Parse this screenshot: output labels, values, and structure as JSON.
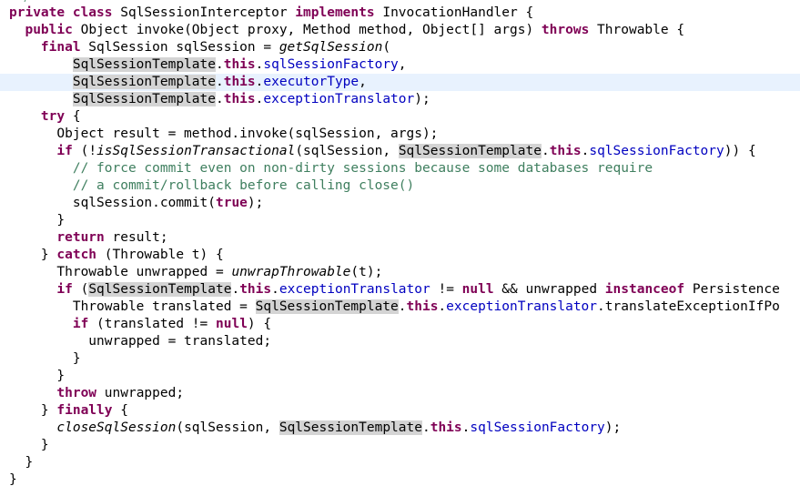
{
  "editor": {
    "lines": [
      [
        {
          "t": "private",
          "c": "kw"
        },
        {
          "t": " "
        },
        {
          "t": "class",
          "c": "kw"
        },
        {
          "t": " SqlSessionInterceptor "
        },
        {
          "t": "implements",
          "c": "kw"
        },
        {
          "t": " InvocationHandler {"
        }
      ],
      [
        {
          "t": "  "
        },
        {
          "t": "public",
          "c": "kw"
        },
        {
          "t": " Object invoke(Object proxy, Method method, Object[] args) "
        },
        {
          "t": "throws",
          "c": "kw"
        },
        {
          "t": " Throwable {"
        }
      ],
      [
        {
          "t": "    "
        },
        {
          "t": "final",
          "c": "kw"
        },
        {
          "t": " SqlSession sqlSession = "
        },
        {
          "t": "getSqlSession",
          "c": "static"
        },
        {
          "t": "("
        }
      ],
      [
        {
          "t": "        "
        },
        {
          "t": "SqlSessionTemplate",
          "c": "hl"
        },
        {
          "t": "."
        },
        {
          "t": "this",
          "c": "kw"
        },
        {
          "t": "."
        },
        {
          "t": "sqlSessionFactory",
          "c": "field"
        },
        {
          "t": ","
        }
      ],
      [
        {
          "t": "        "
        },
        {
          "t": "SqlSessionTemplate",
          "c": "hl"
        },
        {
          "t": "."
        },
        {
          "t": "this",
          "c": "kw"
        },
        {
          "t": "."
        },
        {
          "t": "executorType",
          "c": "field"
        },
        {
          "t": ","
        }
      ],
      [
        {
          "t": "        "
        },
        {
          "t": "SqlSessionTemplate",
          "c": "hl"
        },
        {
          "t": "."
        },
        {
          "t": "this",
          "c": "kw"
        },
        {
          "t": "."
        },
        {
          "t": "exceptionTranslator",
          "c": "field"
        },
        {
          "t": ");"
        }
      ],
      [
        {
          "t": "    "
        },
        {
          "t": "try",
          "c": "kw"
        },
        {
          "t": " {"
        }
      ],
      [
        {
          "t": "      Object result = method.invoke(sqlSession, args);"
        }
      ],
      [
        {
          "t": "      "
        },
        {
          "t": "if",
          "c": "kw"
        },
        {
          "t": " (!"
        },
        {
          "t": "isSqlSessionTransactional",
          "c": "static"
        },
        {
          "t": "(sqlSession, "
        },
        {
          "t": "SqlSessionTemplate",
          "c": "hl"
        },
        {
          "t": "."
        },
        {
          "t": "this",
          "c": "kw"
        },
        {
          "t": "."
        },
        {
          "t": "sqlSessionFactory",
          "c": "field"
        },
        {
          "t": ")) {"
        }
      ],
      [
        {
          "t": "        "
        },
        {
          "t": "// force commit even on non-dirty sessions because some databases require",
          "c": "comment"
        }
      ],
      [
        {
          "t": "        "
        },
        {
          "t": "// a commit/rollback before calling close()",
          "c": "comment"
        }
      ],
      [
        {
          "t": "        sqlSession.commit("
        },
        {
          "t": "true",
          "c": "kw"
        },
        {
          "t": ");"
        }
      ],
      [
        {
          "t": "      }"
        }
      ],
      [
        {
          "t": "      "
        },
        {
          "t": "return",
          "c": "kw"
        },
        {
          "t": " result;"
        }
      ],
      [
        {
          "t": "    } "
        },
        {
          "t": "catch",
          "c": "kw"
        },
        {
          "t": " (Throwable t) {"
        }
      ],
      [
        {
          "t": "      Throwable unwrapped = "
        },
        {
          "t": "unwrapThrowable",
          "c": "static"
        },
        {
          "t": "(t);"
        }
      ],
      [
        {
          "t": "      "
        },
        {
          "t": "if",
          "c": "kw"
        },
        {
          "t": " ("
        },
        {
          "t": "SqlSessionTemplate",
          "c": "hl"
        },
        {
          "t": "."
        },
        {
          "t": "this",
          "c": "kw"
        },
        {
          "t": "."
        },
        {
          "t": "exceptionTranslator",
          "c": "field"
        },
        {
          "t": " != "
        },
        {
          "t": "null",
          "c": "kw"
        },
        {
          "t": " && unwrapped "
        },
        {
          "t": "instanceof",
          "c": "kw"
        },
        {
          "t": " Persistence"
        }
      ],
      [
        {
          "t": "        Throwable translated = "
        },
        {
          "t": "SqlSessionTemplate",
          "c": "hl"
        },
        {
          "t": "."
        },
        {
          "t": "this",
          "c": "kw"
        },
        {
          "t": "."
        },
        {
          "t": "exceptionTranslator",
          "c": "field"
        },
        {
          "t": ".translateExceptionIfPo"
        }
      ],
      [
        {
          "t": "        "
        },
        {
          "t": "if",
          "c": "kw"
        },
        {
          "t": " (translated != "
        },
        {
          "t": "null",
          "c": "kw"
        },
        {
          "t": ") {"
        }
      ],
      [
        {
          "t": "          unwrapped = translated;"
        }
      ],
      [
        {
          "t": "        }"
        }
      ],
      [
        {
          "t": "      }"
        }
      ],
      [
        {
          "t": "      "
        },
        {
          "t": "throw",
          "c": "kw"
        },
        {
          "t": " unwrapped;"
        }
      ],
      [
        {
          "t": "    } "
        },
        {
          "t": "finally",
          "c": "kw"
        },
        {
          "t": " {"
        }
      ],
      [
        {
          "t": "      "
        },
        {
          "t": "closeSqlSession",
          "c": "static"
        },
        {
          "t": "(sqlSession, "
        },
        {
          "t": "SqlSessionTemplate",
          "c": "hl"
        },
        {
          "t": "."
        },
        {
          "t": "this",
          "c": "kw"
        },
        {
          "t": "."
        },
        {
          "t": "sqlSessionFactory",
          "c": "field"
        },
        {
          "t": ");"
        }
      ],
      [
        {
          "t": "    }"
        }
      ],
      [
        {
          "t": "  }"
        }
      ],
      [
        {
          "t": "}"
        }
      ]
    ],
    "current_line_index": 4
  },
  "colors": {
    "keyword": "#7f0055",
    "field": "#0000c0",
    "comment": "#3f7f5f",
    "occurrence_highlight": "#d4d4d4",
    "current_line": "#e8f2fe",
    "background": "#ffffff"
  }
}
